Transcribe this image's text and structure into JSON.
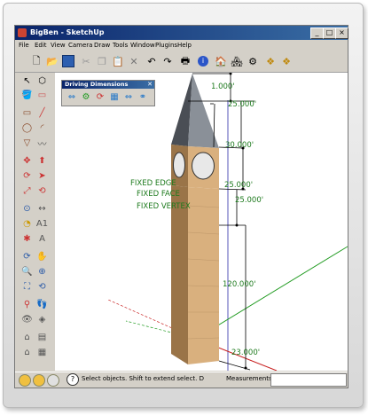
{
  "window": {
    "title": "BigBen - SketchUp",
    "controls": [
      "_",
      "□",
      "×"
    ]
  },
  "menu": [
    "File",
    "Edit",
    "View",
    "Camera",
    "Draw",
    "Tools",
    "Window",
    "Plugins",
    "Help"
  ],
  "toolbar_icons": [
    "new-icon",
    "open-icon",
    "save-icon",
    "cut-icon",
    "copy-icon",
    "paste-icon",
    "erase-icon",
    "undo-icon",
    "redo-icon",
    "print-icon",
    "model-info-icon",
    "get-models-icon",
    "share-model-icon",
    "share-component-icon",
    "extension-icon"
  ],
  "driving_dimensions": {
    "title": "Driving Dimensions",
    "icons": [
      "dimension-tool-icon",
      "dimension-settings-icon",
      "dimension-refresh-icon",
      "dimension-table-icon",
      "dimension-fix-icon",
      "dimension-help-icon"
    ]
  },
  "annotations": {
    "top": "1.000'",
    "d1": "25.000'",
    "d2": "30.000'",
    "d3": "25.000'",
    "d4": "25.000'",
    "d5": "120.000'",
    "d6": "23.000'",
    "fixed_edge": "FIXED EDGE",
    "fixed_face": "FIXED FACE",
    "fixed_vertex": "FIXED VERTEX"
  },
  "status": {
    "message": "Select objects. Shift to extend select. Drag",
    "measurements_label": "Measurements"
  },
  "colors": {
    "dimension_text": "#1d7a1d",
    "tower_body": "#d9b07e",
    "tower_dark": "#9a7448",
    "roof": "#7a8088",
    "axis_blue": "#2a2aa8",
    "axis_green": "#1f9a1f",
    "axis_red": "#c82020"
  }
}
